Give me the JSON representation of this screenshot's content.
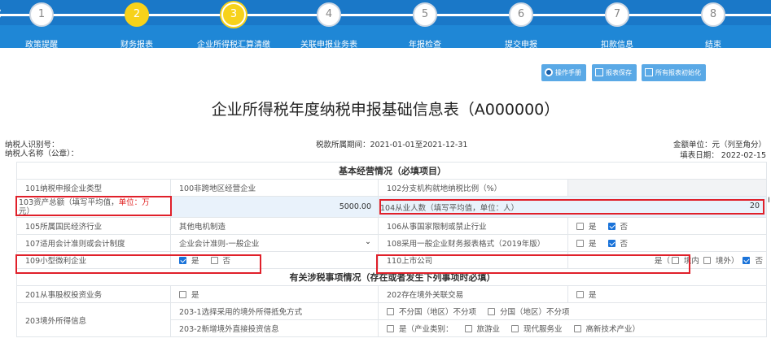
{
  "stepper": {
    "steps": [
      {
        "num": "1",
        "label": "政策提醒",
        "state": "pending"
      },
      {
        "num": "2",
        "label": "财务报表",
        "state": "done"
      },
      {
        "num": "3",
        "label": "企业所得税汇算清缴",
        "state": "active"
      },
      {
        "num": "4",
        "label": "关联申报业务表",
        "state": "pending"
      },
      {
        "num": "5",
        "label": "年报检查",
        "state": "pending"
      },
      {
        "num": "6",
        "label": "提交申报",
        "state": "pending"
      },
      {
        "num": "7",
        "label": "扣款信息",
        "state": "pending"
      },
      {
        "num": "8",
        "label": "结束",
        "state": "pending"
      }
    ]
  },
  "toolbar": {
    "manual_label": "操作手册",
    "save_label": "报表保存",
    "init_label": "所有报表初始化"
  },
  "form": {
    "title": "企业所得税年度纳税申报基础信息表（A000000）",
    "taxpayer_id_label": "纳税人识别号：",
    "taxpayer_name_label": "纳税人名称（公章）：",
    "period": "税款所属期间：2021-01-01至2021-12-31",
    "unit": "金额单位：元（列至角分）",
    "fill_date": "填表日期： 2022-02-15"
  },
  "table": {
    "section1": "基本经营情况（必填项目）",
    "r101_label": "101纳税申报企业类型",
    "r101_value": "100非跨地区经营企业",
    "r102_label": "102分支机构就地纳税比例（%）",
    "r103_label": "103资产总额（填写平均值，",
    "r103_label_red": "单位：万",
    "r103_label_end": "元）",
    "r103_value": "5000.00",
    "r104_label": "104从业人数（填写平均值，单位：人）",
    "r104_value": "20",
    "r105_label": "105所属国民经济行业",
    "r105_value": "其他电机制造",
    "r106_label": "106从事国家限制或禁止行业",
    "r107_label": "107适用会计准则或会计制度",
    "r107_value": "企业会计准则-一般企业",
    "r108_label": "108采用一般企业财务报表格式（2019年版）",
    "r109_label": "109小型微利企业",
    "r110_label": "110上市公司",
    "r110_prefix": "是（",
    "r110_domestic": "境内",
    "r110_overseas": "境外）",
    "yes": "是",
    "no": "否",
    "section2": "有关涉税事项情况（存在或者发生下列事项时必填）",
    "r201_label": "201从事股权投资业务",
    "r202_label": "202存在境外关联交易",
    "r203_label": "203境外所得信息",
    "r2031_label": "203-1选择采用的境外所得抵免方式",
    "r2031_opt1": "不分国（地区）不分项",
    "r2031_opt2": "分国（地区）不分项",
    "r2032_label": "203-2新增境外直接投资信息",
    "r2032_opt1": "是（产业类别：",
    "r2032_opt2": "旅游业",
    "r2032_opt3": "现代服务业",
    "r2032_opt4": "高新技术产业）"
  },
  "edge_mark": "I",
  "colors": {
    "header_blue": "#1a78c8",
    "step_yellow": "#f7d21b",
    "highlight_red": "#e0202a",
    "input_bg": "#e9f2fb"
  }
}
